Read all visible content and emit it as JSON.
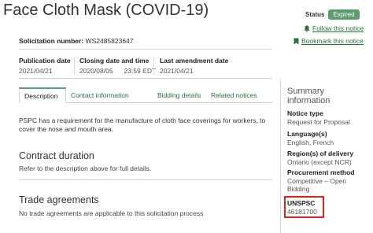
{
  "notice": {
    "title": "Face Cloth Mask (COVID-19)",
    "status_label": "Status",
    "status_value": "Expired",
    "solicitation_label": "Solicitation number:",
    "solicitation_number": "WS2485823647"
  },
  "actions": {
    "follow": "Follow this notice",
    "bookmark": "Bookmark this notice"
  },
  "dates": {
    "publication_label": "Publication date",
    "publication_value": "2021/04/21",
    "closing_label": "Closing date and time",
    "closing_date": "2020/08/05",
    "closing_time": "23:59 EDT",
    "amendment_label": "Last amendment date",
    "amendment_value": "2021/04/21"
  },
  "tabs": [
    "Description",
    "Contact information",
    "Bidding details",
    "Related notices"
  ],
  "description": {
    "text": "PSPC has a requirement for the manufacture of cloth face coverings for workers, to cover the nose and mouth area."
  },
  "sections": [
    {
      "title": "Contract duration",
      "text": "Refer to the description above for full details."
    },
    {
      "title": "Trade agreements",
      "text": "No trade agreements are applicable to this solicitation process"
    }
  ],
  "summary": {
    "title": "Summary information",
    "items": [
      {
        "label": "Notice type",
        "value": "Request for Proposal"
      },
      {
        "label": "Language(s)",
        "value": "English, French"
      },
      {
        "label": "Region(s) of delivery",
        "value": "Ontario (except NCR)"
      },
      {
        "label": "Procurement method",
        "value": "Competitive – Open Bidding"
      },
      {
        "label": "UNSPSC",
        "value": "46181700"
      }
    ]
  },
  "colors": {
    "accent_green": "#2b6e3f",
    "badge_green": "#5e9b6d",
    "highlight_red": "#e01f1f"
  },
  "icons": {
    "follow": "bell-icon",
    "bookmark": "bookmark-icon"
  }
}
